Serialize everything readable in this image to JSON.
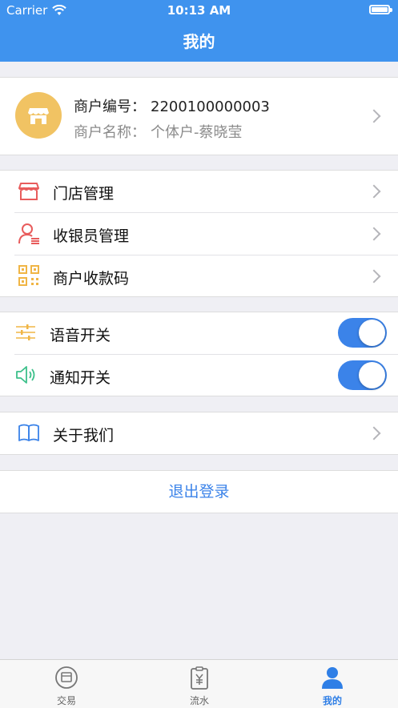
{
  "status_bar": {
    "carrier": "Carrier",
    "time": "10:13 AM"
  },
  "nav": {
    "title": "我的"
  },
  "merchant": {
    "id_label": "商户编号：",
    "id_value": "2200100000003",
    "name_label": "商户名称：",
    "name_value": "个体户-蔡晓莹",
    "avatar_icon": "store-icon"
  },
  "menu": [
    {
      "label": "门店管理",
      "icon": "store-outline-icon"
    },
    {
      "label": "收银员管理",
      "icon": "cashier-user-icon"
    },
    {
      "label": "商户收款码",
      "icon": "qr-code-icon"
    }
  ],
  "toggles": [
    {
      "label": "语音开关",
      "icon": "sliders-icon",
      "on": true
    },
    {
      "label": "通知开关",
      "icon": "speaker-icon",
      "on": true
    }
  ],
  "about": {
    "label": "关于我们",
    "icon": "book-icon"
  },
  "logout": {
    "label": "退出登录"
  },
  "tabs": [
    {
      "label": "交易",
      "icon": "transaction-icon",
      "active": false
    },
    {
      "label": "流水",
      "icon": "yuan-clipboard-icon",
      "active": false
    },
    {
      "label": "我的",
      "icon": "person-icon",
      "active": true
    }
  ],
  "colors": {
    "primary": "#3f93ee",
    "accent_blue": "#3b83e9",
    "avatar_bg": "#f1c363"
  }
}
